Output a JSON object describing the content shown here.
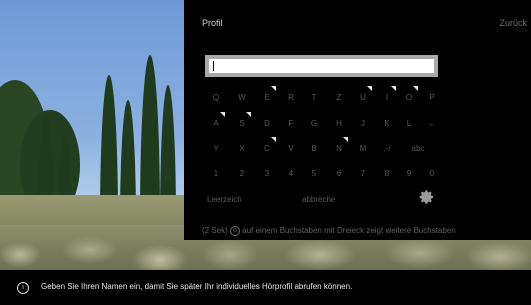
{
  "panel": {
    "title": "Profil",
    "back_label": "Zurück",
    "input_value": ""
  },
  "keyboard": {
    "rows": [
      [
        {
          "k": "Q"
        },
        {
          "k": "W"
        },
        {
          "k": "E",
          "more": true
        },
        {
          "k": "R"
        },
        {
          "k": "T"
        },
        {
          "k": "Z"
        },
        {
          "k": "U",
          "more": true
        },
        {
          "k": "I",
          "more": true
        },
        {
          "k": "O",
          "more": true
        },
        {
          "k": "P"
        }
      ],
      [
        {
          "k": "A",
          "more": true
        },
        {
          "k": "S",
          "more": true
        },
        {
          "k": "D"
        },
        {
          "k": "F"
        },
        {
          "k": "G"
        },
        {
          "k": "H"
        },
        {
          "k": "J"
        },
        {
          "k": "K"
        },
        {
          "k": "L"
        },
        {
          "k": "←"
        }
      ],
      [
        {
          "k": "Y"
        },
        {
          "k": "X"
        },
        {
          "k": "C",
          "more": true
        },
        {
          "k": "V"
        },
        {
          "k": "B"
        },
        {
          "k": "N",
          "more": true
        },
        {
          "k": "M"
        },
        {
          "k": ".-/"
        },
        {
          "k": "abc"
        }
      ],
      [
        {
          "k": "1"
        },
        {
          "k": "2"
        },
        {
          "k": "3"
        },
        {
          "k": "4"
        },
        {
          "k": "5"
        },
        {
          "k": "6"
        },
        {
          "k": "7"
        },
        {
          "k": "8"
        },
        {
          "k": "9"
        },
        {
          "k": "0"
        }
      ]
    ],
    "space_label": "Leerzeich",
    "cancel_label": "abbreche",
    "settings_icon": "gear-icon"
  },
  "hint": {
    "prefix": "(2 Sek)",
    "button": "⊙",
    "text": "auf einem Buchstaben mit Dreieck zeigt weitere Buchstaben"
  },
  "info": {
    "icon": "info-icon",
    "text": "Geben Sie Ihren Namen ein, damit Sie später Ihr individuelles Hörprofil abrufen können."
  }
}
